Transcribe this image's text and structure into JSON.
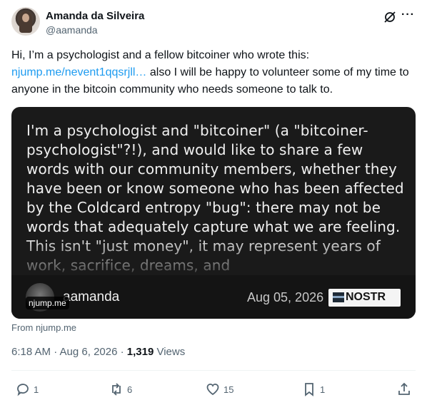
{
  "author": {
    "name": "Amanda da Silveira",
    "handle": "@aamanda"
  },
  "header": {
    "more_icon": "more-dots-icon",
    "grok_icon": "grok-slash-icon"
  },
  "tweet": {
    "text_before": "Hi, I’m a psychologist and a fellow bitcoiner who wrote this:",
    "link": "njump.me/nevent1qqsrjll…",
    "text_after": " also I will be happy to volunteer some of my time to anyone in the bitcoin community who needs someone to talk to."
  },
  "card": {
    "body": "I'm a psychologist and \"bitcoiner\" (a \"bitcoiner-psychologist\"?!), and would like to share a few words with our community members, whether they have been or know someone who has been affected by the Coldcard entropy \"bug\": there may not be words that adequately capture what we are feeling. This isn't \"just money\", it may represent years of work, sacrifice, dreams, and",
    "author": "aamanda",
    "date": "Aug 05, 2026",
    "badge": "NOSTR",
    "domain": "njump.me"
  },
  "source": "From njump.me",
  "meta": {
    "time": "6:18 AM · Aug 6, 2026 · ",
    "views": "1,319",
    "views_label": " Views"
  },
  "actions": {
    "replies": "1",
    "reposts": "6",
    "likes": "15",
    "bookmarks": "1"
  },
  "colors": {
    "link": "#1d9bf0",
    "secondary_text": "#536471",
    "card_bg": "#1a1a1a"
  }
}
